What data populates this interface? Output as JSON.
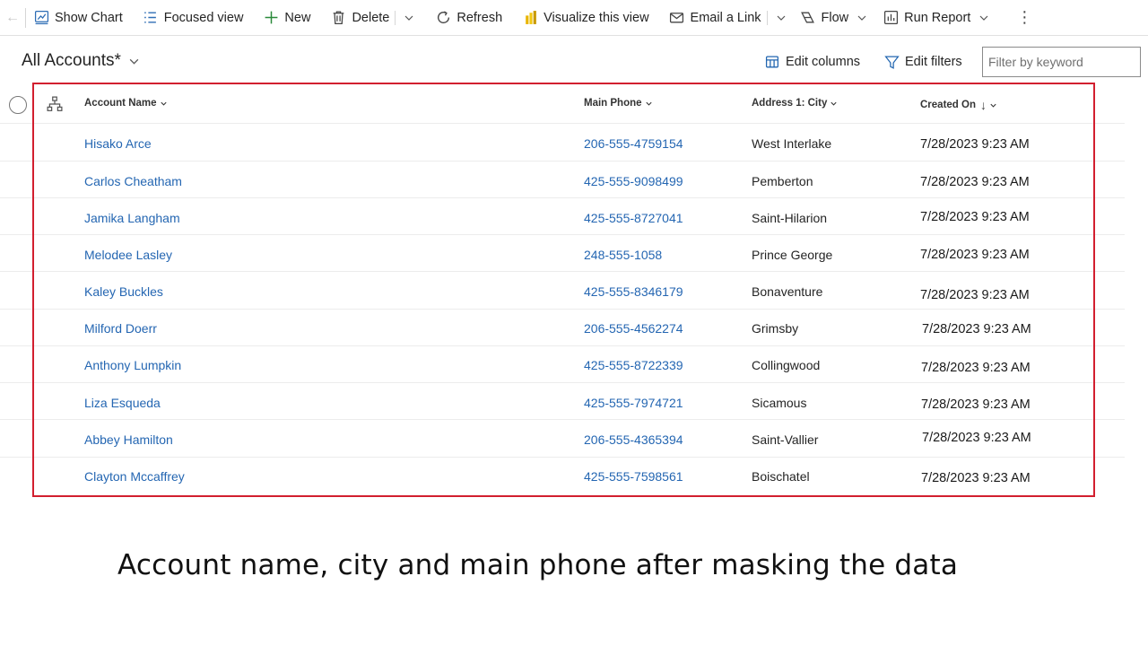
{
  "toolbar": {
    "show_chart": "Show Chart",
    "focused_view": "Focused view",
    "new": "New",
    "delete": "Delete",
    "refresh": "Refresh",
    "visualize": "Visualize this view",
    "email_link": "Email a Link",
    "flow": "Flow",
    "run_report": "Run Report",
    "more": "⋮"
  },
  "view": {
    "title": "All Accounts*",
    "edit_columns": "Edit columns",
    "edit_filters": "Edit filters",
    "filter_placeholder": "Filter by keyword"
  },
  "grid": {
    "columns": {
      "account_name": "Account Name",
      "main_phone": "Main Phone",
      "city": "Address 1: City",
      "created_on": "Created On",
      "sort_arrow": "↓"
    },
    "rows": [
      {
        "name": "Hisako Arce",
        "phone": "206-555-4759154",
        "city": "West Interlake",
        "created": "7/28/2023 9:23 AM"
      },
      {
        "name": "Carlos Cheatham",
        "phone": "425-555-9098499",
        "city": "Pemberton",
        "created": "7/28/2023 9:23 AM"
      },
      {
        "name": "Jamika Langham",
        "phone": "425-555-8727041",
        "city": "Saint-Hilarion",
        "created": "7/28/2023 9:23 AM"
      },
      {
        "name": "Melodee Lasley",
        "phone": "248-555-1058",
        "city": "Prince George",
        "created": "7/28/2023 9:23 AM"
      },
      {
        "name": "Kaley Buckles",
        "phone": "425-555-8346179",
        "city": "Bonaventure",
        "created": "7/28/2023 9:23 AM"
      },
      {
        "name": "Milford Doerr",
        "phone": "206-555-4562274",
        "city": "Grimsby",
        "created": "7/28/2023 9:23 AM"
      },
      {
        "name": "Anthony Lumpkin",
        "phone": "425-555-8722339",
        "city": "Collingwood",
        "created": "7/28/2023 9:23 AM"
      },
      {
        "name": "Liza Esqueda",
        "phone": "425-555-7974721",
        "city": "Sicamous",
        "created": "7/28/2023 9:23 AM"
      },
      {
        "name": "Abbey Hamilton",
        "phone": "206-555-4365394",
        "city": "Saint-Vallier",
        "created": "7/28/2023 9:23 AM"
      },
      {
        "name": "Clayton Mccaffrey",
        "phone": "425-555-7598561",
        "city": "Boischatel",
        "created": "7/28/2023 9:23 AM"
      }
    ]
  },
  "caption": "Account name, city and main phone after masking the data",
  "colors": {
    "link": "#2466b2",
    "highlight_border": "#d21f2f",
    "accent_icon": "#2266b0"
  },
  "icons": [
    "back-arrow-icon",
    "chart-icon",
    "focused-view-icon",
    "plus-icon",
    "trash-icon",
    "chevron-down-icon",
    "refresh-icon",
    "power-bi-icon",
    "email-link-icon",
    "flow-icon",
    "report-icon",
    "more-vertical-icon",
    "edit-columns-icon",
    "filter-icon",
    "hierarchy-icon"
  ]
}
